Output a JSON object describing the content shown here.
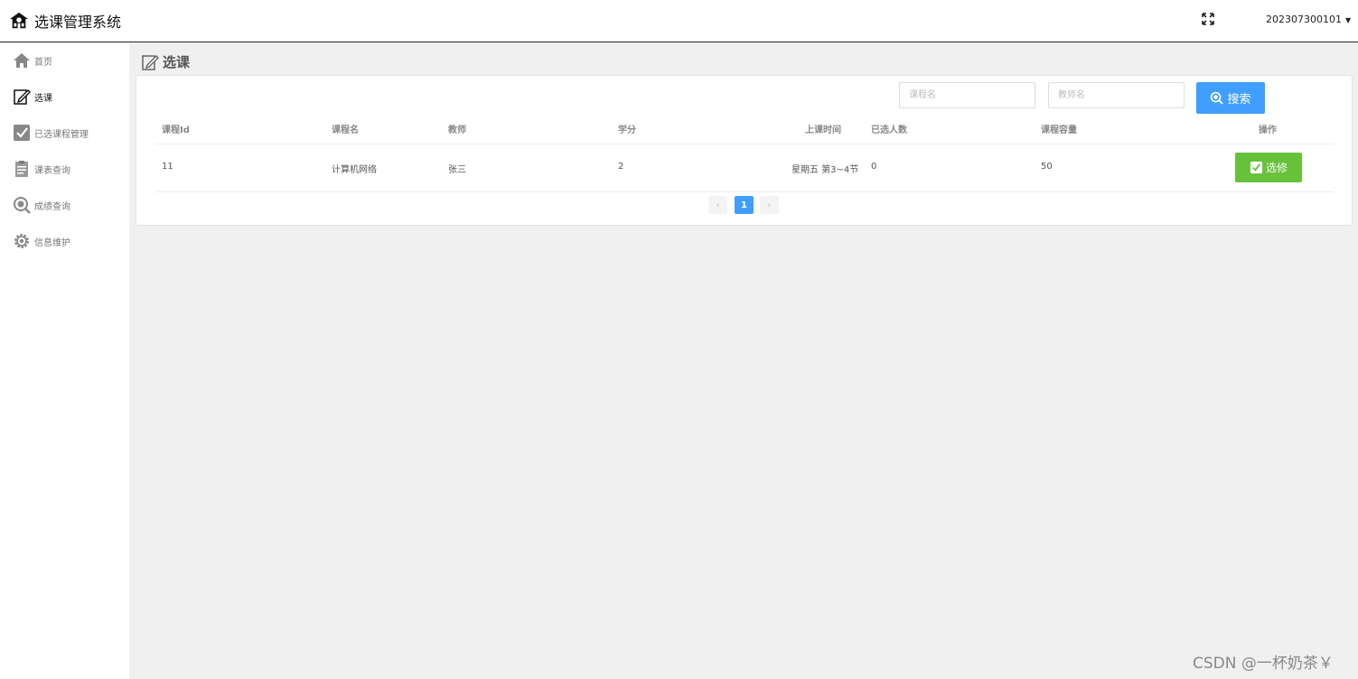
{
  "header": {
    "title": "选课管理系统",
    "logo_icon": "school-icon",
    "fullscreen_icon": "fullscreen-icon",
    "user": "202307300101",
    "user_caret": "▼"
  },
  "sidebar": {
    "items": [
      {
        "label": "首页",
        "icon": "home-icon"
      },
      {
        "label": "选课",
        "icon": "edit-icon",
        "active": true
      },
      {
        "label": "已选课程管理",
        "icon": "checkbox-icon"
      },
      {
        "label": "课表查询",
        "icon": "document-icon"
      },
      {
        "label": "成绩查询",
        "icon": "search-icon"
      },
      {
        "label": "信息维护",
        "icon": "gear-icon"
      }
    ]
  },
  "main": {
    "title": "选课",
    "search": {
      "course_placeholder": "课程名",
      "teacher_placeholder": "教师名",
      "button_label": "搜索"
    },
    "table": {
      "columns": [
        "课程Id",
        "课程名",
        "教师",
        "学分",
        "上课时间",
        "已选人数",
        "课程容量",
        "操作"
      ],
      "rows": [
        {
          "id": "11",
          "name": "计算机网络",
          "teacher": "张三",
          "credit": "2",
          "time": "星期五 第3~4节",
          "selected": "0",
          "capacity": "50",
          "action_label": "选修"
        }
      ]
    },
    "pagination": {
      "prev": "‹",
      "current": "1",
      "next": "›"
    }
  },
  "watermark": "CSDN @一杯奶茶￥",
  "colors": {
    "primary": "#409eff",
    "success": "#67c23a",
    "background": "#f0f0f0"
  }
}
